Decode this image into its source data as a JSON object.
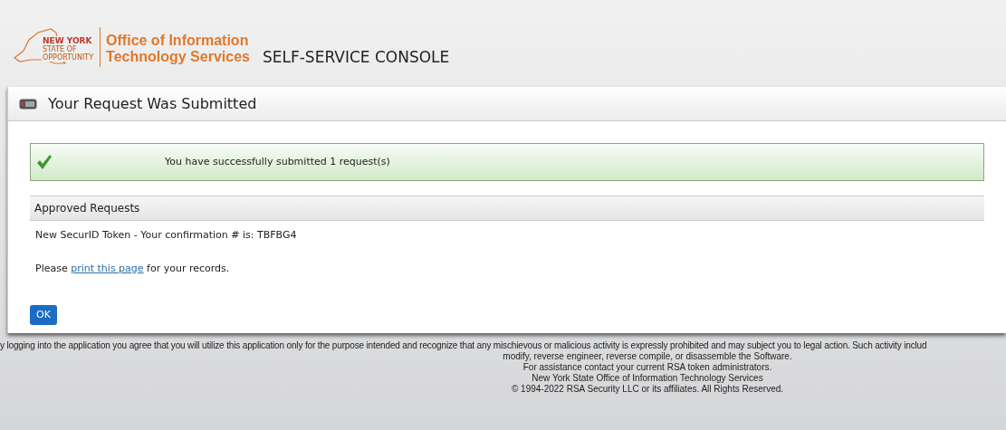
{
  "header": {
    "logo_state": "NEW YORK",
    "logo_tagline": [
      "STATE OF",
      "OPPORTUNITY"
    ],
    "agency": [
      "Office of Information",
      "Technology Services"
    ],
    "console_title": "SELF-SERVICE CONSOLE"
  },
  "panel": {
    "title": "Your Request Was Submitted",
    "success_message": "You have successfully submitted 1 request(s)",
    "section_title": "Approved Requests",
    "confirmation": "New SecurID Token - Your confirmation # is: TBFBG4",
    "print_note": {
      "before": "Please",
      "link": "print this page",
      "after": "for your records."
    },
    "ok_button": "OK"
  },
  "footer": [
    "y logging into the application you agree that you will utilize this application only for the purpose intended and recognize that any mischievous or malicious activity is expressly prohibited and may subject you to legal action. Such activity includ",
    "modify, reverse engineer, reverse compile, or disassemble the Software.",
    "For assistance contact your current RSA token administrators.",
    "New York State Office of Information Technology Services",
    "© 1994-2022 RSA Security LLC or its affiliates. All Rights Reserved."
  ]
}
